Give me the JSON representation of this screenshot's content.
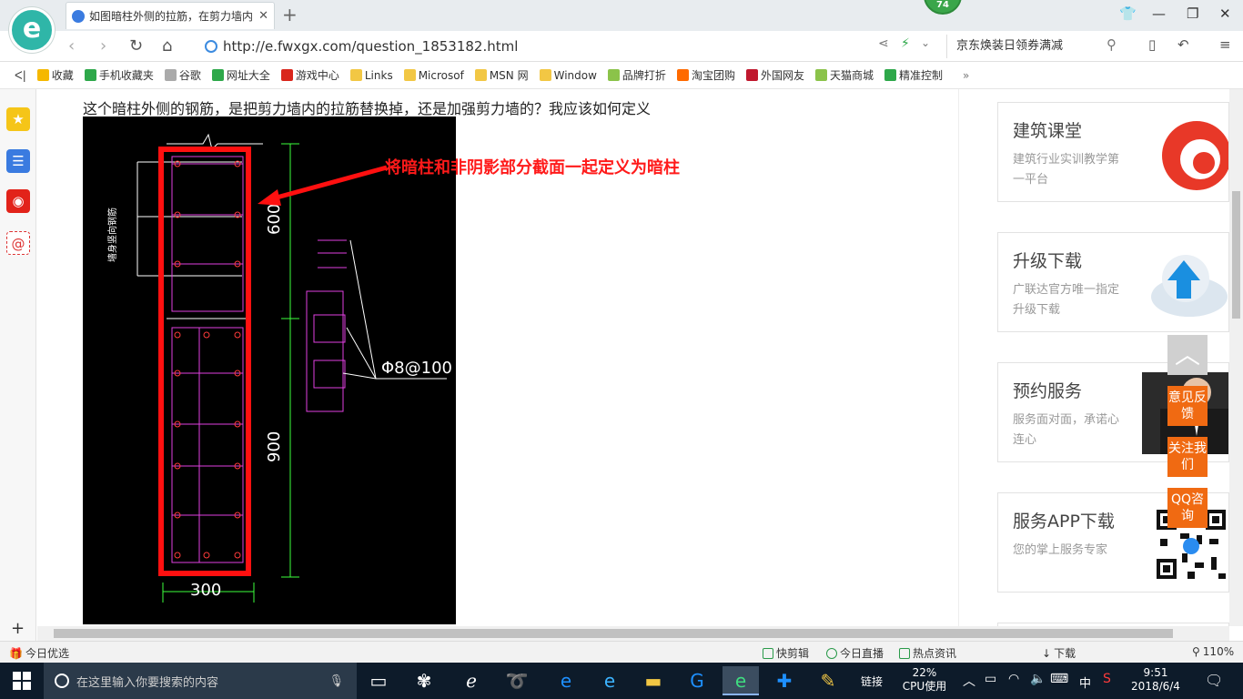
{
  "browser": {
    "tab_title": "如图暗柱外侧的拉筋，在剪力墙内",
    "badge": "74",
    "url": "http://e.fwxgx.com/question_1853182.html",
    "search_text": "京东焕装日领券满减"
  },
  "bookmarks": [
    {
      "label": "收藏",
      "color": "#f5b800"
    },
    {
      "label": "手机收藏夹",
      "color": "#2ea84a"
    },
    {
      "label": "谷歌",
      "color": "#aaaaaa"
    },
    {
      "label": "网址大全",
      "color": "#2ea84a"
    },
    {
      "label": "游戏中心",
      "color": "#d9261c"
    },
    {
      "label": "Links",
      "color": "#f2c744"
    },
    {
      "label": "Microsof",
      "color": "#f2c744"
    },
    {
      "label": "MSN 网",
      "color": "#f2c744"
    },
    {
      "label": "Window",
      "color": "#f2c744"
    },
    {
      "label": "品牌打折",
      "color": "#8bc34a"
    },
    {
      "label": "淘宝团购",
      "color": "#ff6a00"
    },
    {
      "label": "外国网友",
      "color": "#c0182e"
    },
    {
      "label": "天猫商城",
      "color": "#8bc34a"
    },
    {
      "label": "精准控制",
      "color": "#2ea84a"
    }
  ],
  "page": {
    "question": "这个暗柱外侧的钢筋，是把剪力墙内的拉筋替换掉，还是加强剪力墙的？我应该如何定义",
    "annotation": "将暗柱和非阴影部分截面一起定义为暗柱",
    "drawing": {
      "dim_top": "600",
      "dim_bottom": "900",
      "dim_width": "300",
      "rebar_label": "Φ8@100",
      "side_text": "墙身竖向钢筋"
    }
  },
  "sidebar_cards": [
    {
      "title": "建筑课堂",
      "desc": "建筑行业实训教学第一平台",
      "art": "logo-swirl"
    },
    {
      "title": "升级下载",
      "desc": "广联达官方唯一指定升级下载",
      "art": "cloud-upload"
    },
    {
      "title": "预约服务",
      "desc": "服务面对面，承诺心连心",
      "art": "person-photo"
    },
    {
      "title": "服务APP下载",
      "desc": "您的掌上服务专家",
      "art": "qr-code"
    }
  ],
  "float_buttons": [
    {
      "label": "意见反馈"
    },
    {
      "label": "关注我们"
    },
    {
      "label": "QQ咨询"
    }
  ],
  "status": {
    "left": "今日优选",
    "items": [
      "快剪辑",
      "今日直播",
      "热点资讯",
      "下载"
    ],
    "zoom": "110%"
  },
  "taskbar": {
    "search_placeholder": "在这里输入你要搜索的内容",
    "links": "链接",
    "cpu_percent": "22%",
    "cpu_label": "CPU使用",
    "ime": "中",
    "time": "9:51",
    "date": "2018/6/4"
  }
}
